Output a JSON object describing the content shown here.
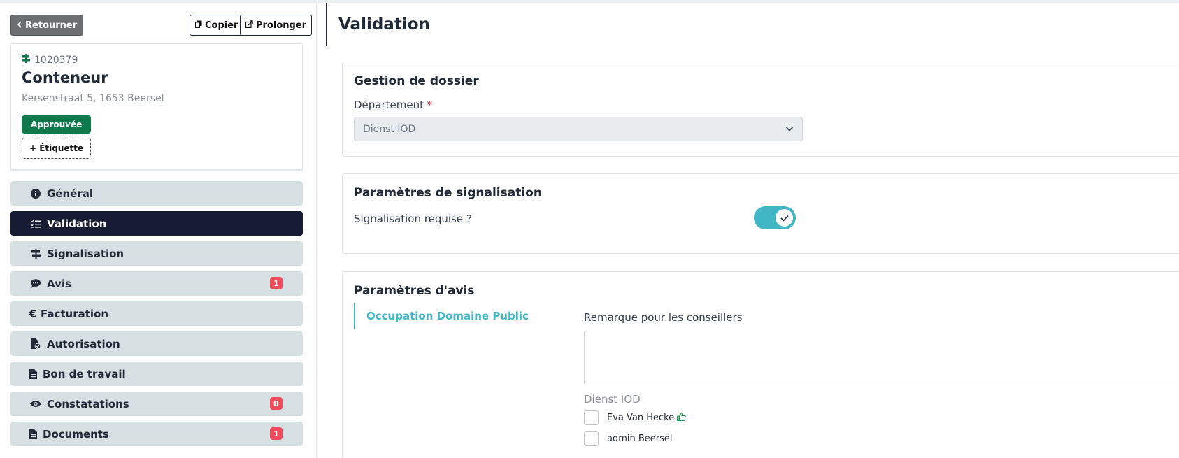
{
  "sidebar": {
    "back_label": "Retourner",
    "copy_label": "Copier",
    "extend_label": "Prolonger",
    "card": {
      "id": "1020379",
      "title": "Conteneur",
      "address": "Kersenstraat 5, 1653 Beersel",
      "status": "Approuvée",
      "tag_button": "+ Étiquette"
    },
    "nav": [
      {
        "label": "Général",
        "icon": "info-icon",
        "count": null,
        "active": false
      },
      {
        "label": "Validation",
        "icon": "checklist-icon",
        "count": null,
        "active": true
      },
      {
        "label": "Signalisation",
        "icon": "signpost-icon",
        "count": null,
        "active": false
      },
      {
        "label": "Avis",
        "icon": "comment-icon",
        "count": "1",
        "active": false
      },
      {
        "label": "Facturation",
        "icon": "euro-icon",
        "count": null,
        "active": false
      },
      {
        "label": "Autorisation",
        "icon": "file-check-icon",
        "count": null,
        "active": false
      },
      {
        "label": "Bon de travail",
        "icon": "file-icon",
        "count": null,
        "active": false
      },
      {
        "label": "Constatations",
        "icon": "eye-icon",
        "count": "0",
        "active": false
      },
      {
        "label": "Documents",
        "icon": "file-icon",
        "count": "1",
        "active": false
      }
    ]
  },
  "main": {
    "title": "Validation",
    "dossier": {
      "title": "Gestion de dossier",
      "department_label": "Département",
      "required_mark": "*",
      "department_value": "Dienst IOD"
    },
    "signalisation": {
      "title": "Paramètres de signalisation",
      "required_label": "Signalisation requise ?",
      "required_value": true
    },
    "avis": {
      "title": "Paramètres d'avis",
      "tab_label": "Occupation Domaine Public",
      "remark_label": "Remarque pour les conseillers",
      "remark_value": "",
      "group_label": "Dienst IOD",
      "advisors": [
        {
          "name": "Eva Van Hecke",
          "icon": "thumbs-up-icon",
          "checked": false
        },
        {
          "name": "admin Beersel",
          "icon": null,
          "checked": false
        }
      ]
    }
  },
  "colors": {
    "accent": "#41b6c4",
    "nav_active": "#161c33",
    "nav_bg": "#d6e0e2",
    "status_green": "#0e7a4c",
    "count_red": "#ef4b5a"
  }
}
